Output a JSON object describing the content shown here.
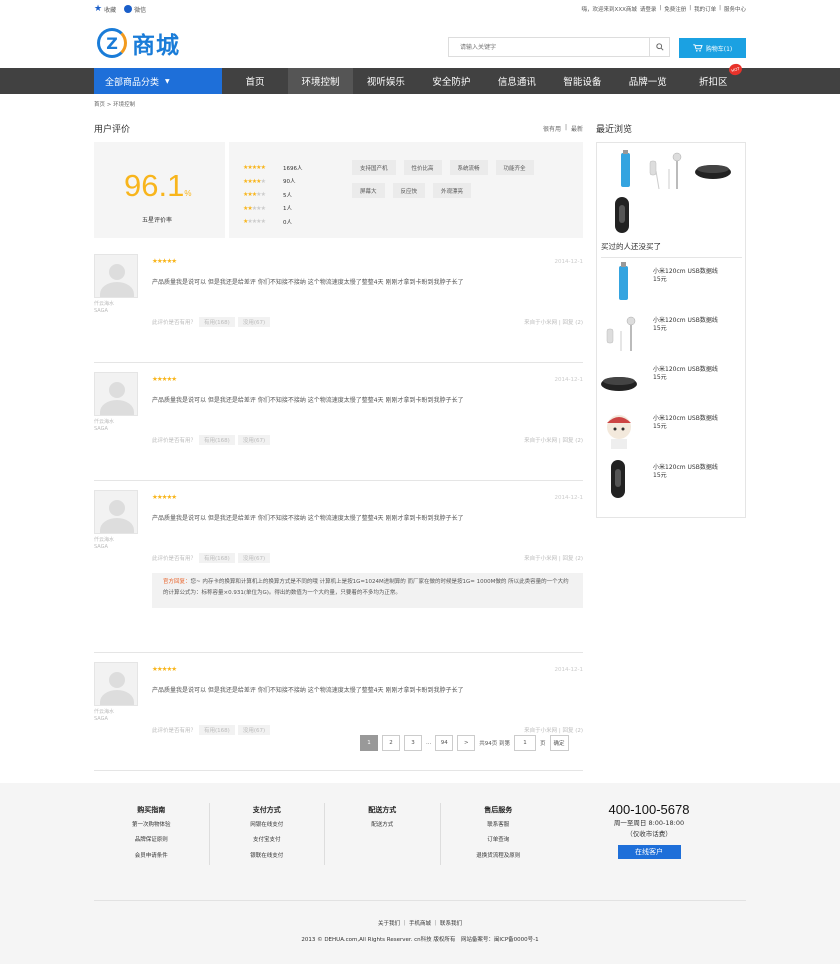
{
  "topbar": {
    "favorite": "收藏",
    "wechat": "微信",
    "welcome": "嗨，欢迎来到XXX商城",
    "login": "请登录",
    "register": "免费注册",
    "orders": "我的订单",
    "service": "服务中心",
    "sep": "|"
  },
  "header": {
    "logo_letter": "Z",
    "logo_text": "商城",
    "search_placeholder": "请输入关键字",
    "cart_label": "购物车(1)"
  },
  "nav": {
    "category": "全部商品分类",
    "items": [
      "首页",
      "环境控制",
      "视听娱乐",
      "安全防护",
      "信息通讯",
      "智能设备",
      "品牌一览",
      "折扣区"
    ],
    "active_index": 1,
    "hot_badge": "HOT"
  },
  "breadcrumb": "首页 > 环境控制",
  "reviews_section": {
    "title": "用户评价",
    "sort_useful": "很有用",
    "sort_latest": "最新",
    "score": "96.1",
    "score_unit": "%",
    "score_label": "五星评价率",
    "distribution": [
      {
        "stars": 5,
        "count": "1696人"
      },
      {
        "stars": 4,
        "count": "90人"
      },
      {
        "stars": 3,
        "count": "5人"
      },
      {
        "stars": 2,
        "count": "1人"
      },
      {
        "stars": 1,
        "count": "0人"
      }
    ],
    "tags": [
      "支持国产机",
      "性价比高",
      "系统流畅",
      "功能齐全",
      "屏幕大",
      "反应快",
      "外观漂亮"
    ]
  },
  "reviews": [
    {
      "user1": "仟云海水",
      "user2": "SAGA",
      "stars": "★★★★★",
      "date": "2014-12-1",
      "text": "产品质量我是说可以 但是我还是给差评 你们不知接不接纳 这个物流速度太慢了整整4天 刚刚才拿到卡盼到我脖子长了",
      "helpful_q": "此评价是否有用？",
      "yes": "有用(168)",
      "no": "没用(67)",
      "from": "来自于小米网 | 回复 (2)",
      "reply": null
    },
    {
      "user1": "仟云海水",
      "user2": "SAGA",
      "stars": "★★★★★",
      "date": "2014-12-1",
      "text": "产品质量我是说可以 但是我还是给差评 你们不知接不接纳 这个物流速度太慢了整整4天 刚刚才拿到卡盼到我脖子长了",
      "helpful_q": "此评价是否有用？",
      "yes": "有用(168)",
      "no": "没用(67)",
      "from": "来自于小米网 | 回复 (2)",
      "reply": null
    },
    {
      "user1": "仟云海水",
      "user2": "SAGA",
      "stars": "★★★★★",
      "date": "2014-12-1",
      "text": "产品质量我是说可以 但是我还是给差评 你们不知接不接纳 这个物流速度太慢了整整4天 刚刚才拿到卡盼到我脖子长了",
      "helpful_q": "此评价是否有用？",
      "yes": "有用(168)",
      "no": "没用(67)",
      "from": "来自于小米网 | 回复 (2)",
      "reply": {
        "label": "官方回复：",
        "text": "您~ 内存卡的换算和计算机上的换算方式是不同的哦 计算机上是按1G=1024M进制算的 而厂家在做的时候是按1G= 1000M做的 所以此类容量的一个大约的计算公式为：标称容量×0.931(单位为G)。得出的数值为一个大约量，只要着的不多均为正常。"
      }
    },
    {
      "user1": "仟云海水",
      "user2": "SAGA",
      "stars": "★★★★★",
      "date": "2014-12-1",
      "text": "产品质量我是说可以 但是我还是给差评 你们不知接不接纳 这个物流速度太慢了整整4天 刚刚才拿到卡盼到我脖子长了",
      "helpful_q": "此评价是否有用？",
      "yes": "有用(168)",
      "no": "没用(67)",
      "from": "来自于小米网 | 回复 (2)",
      "reply": null
    }
  ],
  "pager": {
    "pages": [
      "1",
      "2",
      "3",
      "...",
      "94"
    ],
    "next": ">",
    "total": "共94页 到第",
    "input": "1",
    "page_unit": "页",
    "confirm": "确定"
  },
  "sidebar": {
    "title": "最近浏览",
    "also_title": "买过的人还没买了",
    "also_items": [
      {
        "name": "小米120cm USB数据线",
        "price": "15元",
        "icon": "usb-cable-icon"
      },
      {
        "name": "小米120cm USB数据线",
        "price": "15元",
        "icon": "earphones-icon"
      },
      {
        "name": "小米120cm USB数据线",
        "price": "15元",
        "icon": "tv-box-icon"
      },
      {
        "name": "小米120cm USB数据线",
        "price": "15元",
        "icon": "doll-icon"
      },
      {
        "name": "小米120cm USB数据线",
        "price": "15元",
        "icon": "band-icon"
      }
    ]
  },
  "footer": {
    "columns": [
      {
        "title": "购买指南",
        "links": [
          "第一次购物体验",
          "品牌保证原则",
          "会员申请条件"
        ]
      },
      {
        "title": "支付方式",
        "links": [
          "网银在线支付",
          "支付宝支付",
          "银联在线支付"
        ]
      },
      {
        "title": "配送方式",
        "links": [
          "配送方式"
        ]
      },
      {
        "title": "售后服务",
        "links": [
          "联系客服",
          "订单查询",
          "退换货流程及原则"
        ]
      }
    ],
    "phone": "400-100-5678",
    "hours": "周一至周日 8:00-18:00",
    "note": "（仅收市话费）",
    "online_btn": "在线客户",
    "links": "关于我们 ｜ 手机商城 ｜ 联系我们",
    "copyright": "2013 © DEHUA.com,All Rights Reserver. cn科技 版权所有　网站备案号：闽ICP备0000号-1"
  },
  "colors": {
    "brand": "#1e6fd9",
    "nav_bg": "#414141",
    "star": "#f8b51c",
    "cart": "#1ba1e2"
  }
}
